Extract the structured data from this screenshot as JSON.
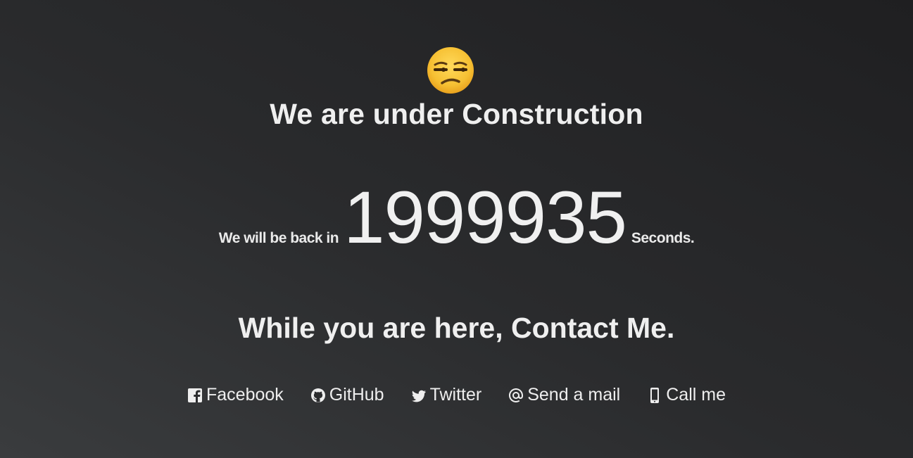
{
  "header": {
    "emoji_icon": "unamused-face-icon",
    "title": "We are under Construction"
  },
  "countdown": {
    "prefix": "We will be back in",
    "value": "1999935",
    "suffix": "Seconds."
  },
  "contact": {
    "title": "While you are here, Contact Me.",
    "links": [
      {
        "label": "Facebook",
        "icon": "facebook-square-icon"
      },
      {
        "label": "GitHub",
        "icon": "github-icon"
      },
      {
        "label": "Twitter",
        "icon": "twitter-icon"
      },
      {
        "label": "Send a mail",
        "icon": "at-sign-icon"
      },
      {
        "label": "Call me",
        "icon": "mobile-phone-icon"
      }
    ]
  },
  "colors": {
    "text": "#eeeeee",
    "background_light": "#3a3c3e",
    "background_dark": "#1f1f21",
    "emoji_yellow": "#f6c033"
  }
}
